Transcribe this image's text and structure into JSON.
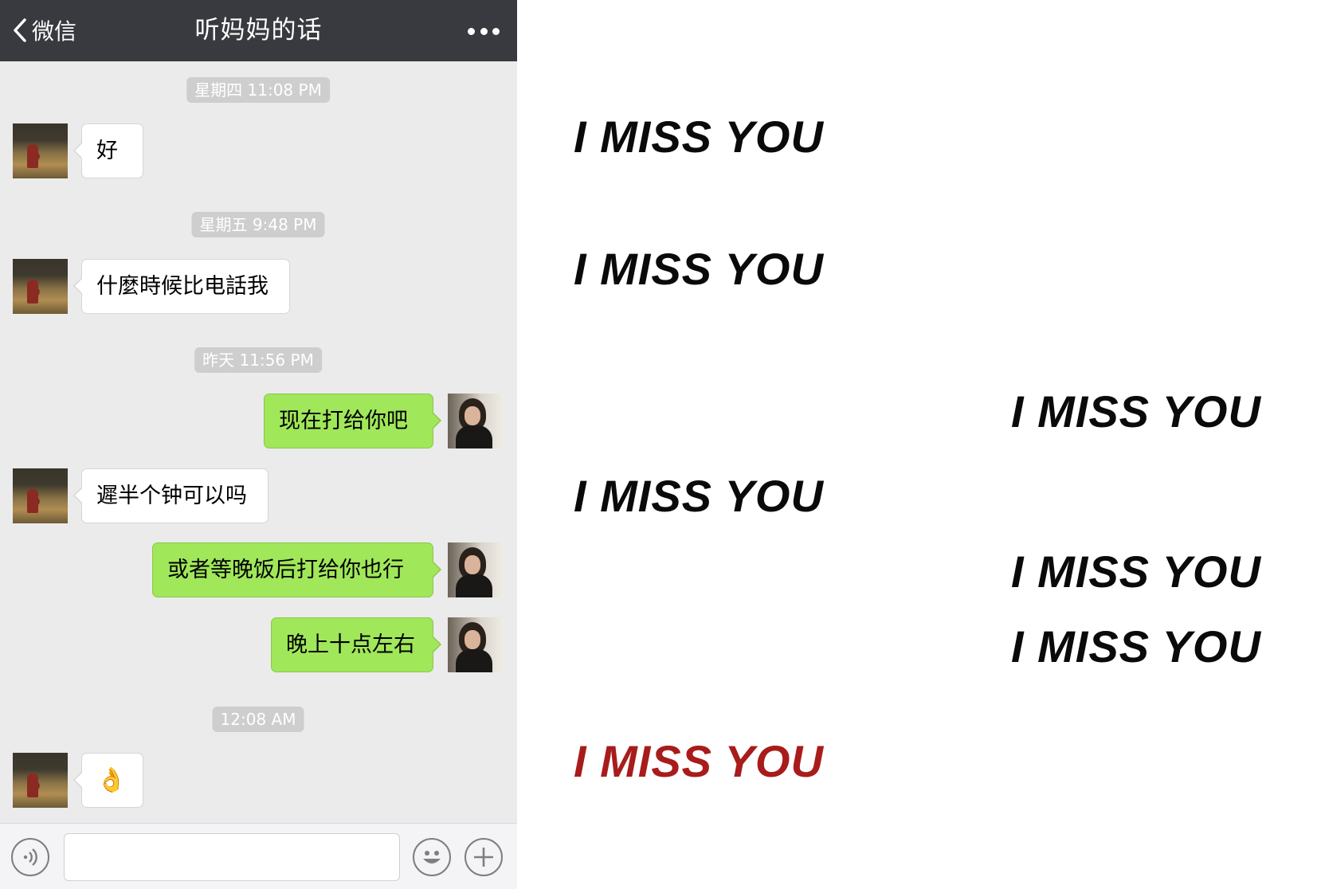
{
  "header": {
    "back_label": "微信",
    "title": "听妈妈的话"
  },
  "timestamps": [
    "星期四 11:08 PM",
    "星期五 9:48 PM",
    "昨天 11:56 PM",
    "12:08 AM"
  ],
  "messages": [
    {
      "side": "in",
      "text": "好"
    },
    {
      "side": "in",
      "text": "什麼時候比电話我"
    },
    {
      "side": "out",
      "text": "现在打给你吧"
    },
    {
      "side": "in",
      "text": "遲半个钟可以吗"
    },
    {
      "side": "out",
      "text": "或者等晚饭后打给你也行"
    },
    {
      "side": "out",
      "text": "晚上十点左右"
    },
    {
      "side": "in",
      "text": "👌"
    }
  ],
  "input": {
    "value": ""
  },
  "poster": {
    "lines": [
      "I MISS YOU",
      "I MISS YOU",
      "I MISS YOU",
      "I MISS YOU",
      "I MISS YOU",
      "I MISS YOU",
      "I MISS YOU"
    ],
    "text_color": "#0a0a0a",
    "accent_color": "#a81c1c"
  },
  "colors": {
    "navbar": "#393a3f",
    "chat_background": "#ebebeb",
    "outgoing_bubble": "#a0e75a",
    "incoming_bubble": "#ffffff",
    "timestamp_pill": "#cecece"
  },
  "icons": {
    "back": "chevron-left-icon",
    "more": "more-dots-icon",
    "voice": "voice-icon",
    "emoji": "emoji-icon",
    "add": "plus-icon"
  }
}
